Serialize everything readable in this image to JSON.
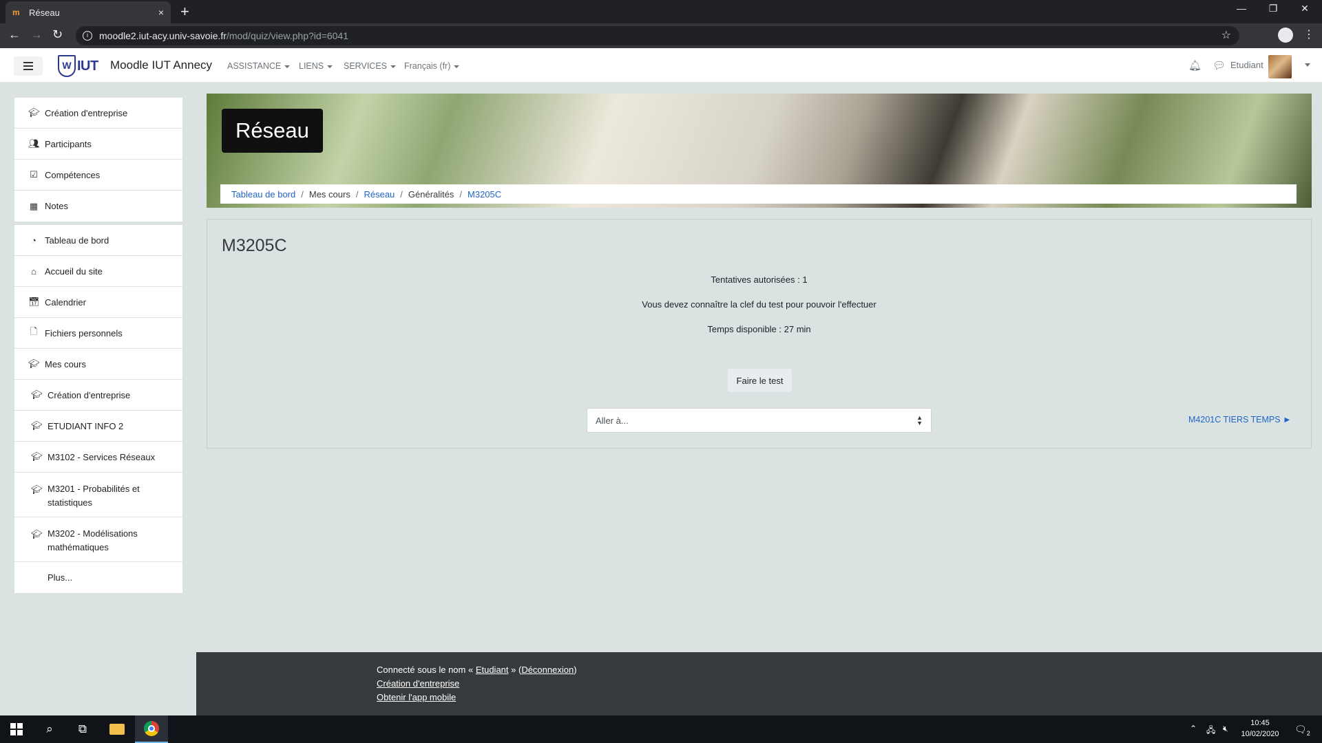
{
  "browser": {
    "tab_favicon": "m",
    "tab_title": "Réseau",
    "tab_close": "×",
    "new_tab": "+",
    "url_host": "moodle2.iut-acy.univ-savoie.fr",
    "url_path": "/mod/quiz/view.php?id=6041"
  },
  "navbar": {
    "logo_text": "IUT",
    "site_name": "Moodle IUT Annecy",
    "menus": [
      "ASSISTANCE",
      "LIENS",
      "SERVICES",
      "Français (fr)"
    ],
    "user_name": "Etudiant"
  },
  "drawer": {
    "course_nav": [
      {
        "icon": "graduation-cap-icon",
        "label": "Création d'entreprise"
      },
      {
        "icon": "users-icon",
        "label": "Participants"
      },
      {
        "icon": "checkbox-icon",
        "label": "Compétences"
      },
      {
        "icon": "table-icon",
        "label": "Notes"
      }
    ],
    "site_nav": [
      {
        "icon": "dashboard-icon",
        "label": "Tableau de bord"
      },
      {
        "icon": "home-icon",
        "label": "Accueil du site"
      },
      {
        "icon": "calendar-icon",
        "label": "Calendrier"
      },
      {
        "icon": "file-icon",
        "label": "Fichiers personnels"
      },
      {
        "icon": "graduation-cap-icon",
        "label": "Mes cours"
      },
      {
        "icon": "graduation-cap-icon",
        "label": "Création d'entreprise"
      },
      {
        "icon": "graduation-cap-icon",
        "label": "ETUDIANT INFO 2"
      },
      {
        "icon": "graduation-cap-icon",
        "label": "M3102 - Services Réseaux"
      },
      {
        "icon": "graduation-cap-icon",
        "label": "M3201 - Probabilités et statistiques"
      },
      {
        "icon": "graduation-cap-icon",
        "label": "M3202 - Modélisations mathématiques"
      },
      {
        "icon": "",
        "label": "Plus..."
      }
    ]
  },
  "header": {
    "course_title": "Réseau",
    "breadcrumb": [
      "Tableau de bord",
      "Mes cours",
      "Réseau",
      "Généralités",
      "M3205C"
    ]
  },
  "quiz": {
    "title": "M3205C",
    "attempts": "Tentatives autorisées : 1",
    "key_notice": "Vous devez connaître la clef du test pour pouvoir l'effectuer",
    "time_limit": "Temps disponible : 27 min",
    "start_button": "Faire le test",
    "jump_placeholder": "Aller à...",
    "next_activity": "M4201C TIERS TEMPS ►"
  },
  "footer": {
    "logged_in_prefix": "Connecté sous le nom « ",
    "logged_in_user": "Etudiant",
    "logged_in_mid": " » (",
    "logout": "Déconnexion",
    "logged_in_suffix": ")",
    "course_link": "Création d'entreprise",
    "mobile_app": "Obtenir l'app mobile"
  },
  "taskbar": {
    "time": "10:45",
    "date": "10/02/2020",
    "notifications": "2"
  },
  "colors": {
    "link": "#1e64c8",
    "page_bg": "#dae3e2",
    "footer_bg": "#373a3c",
    "brand": "#2b3a8c"
  }
}
